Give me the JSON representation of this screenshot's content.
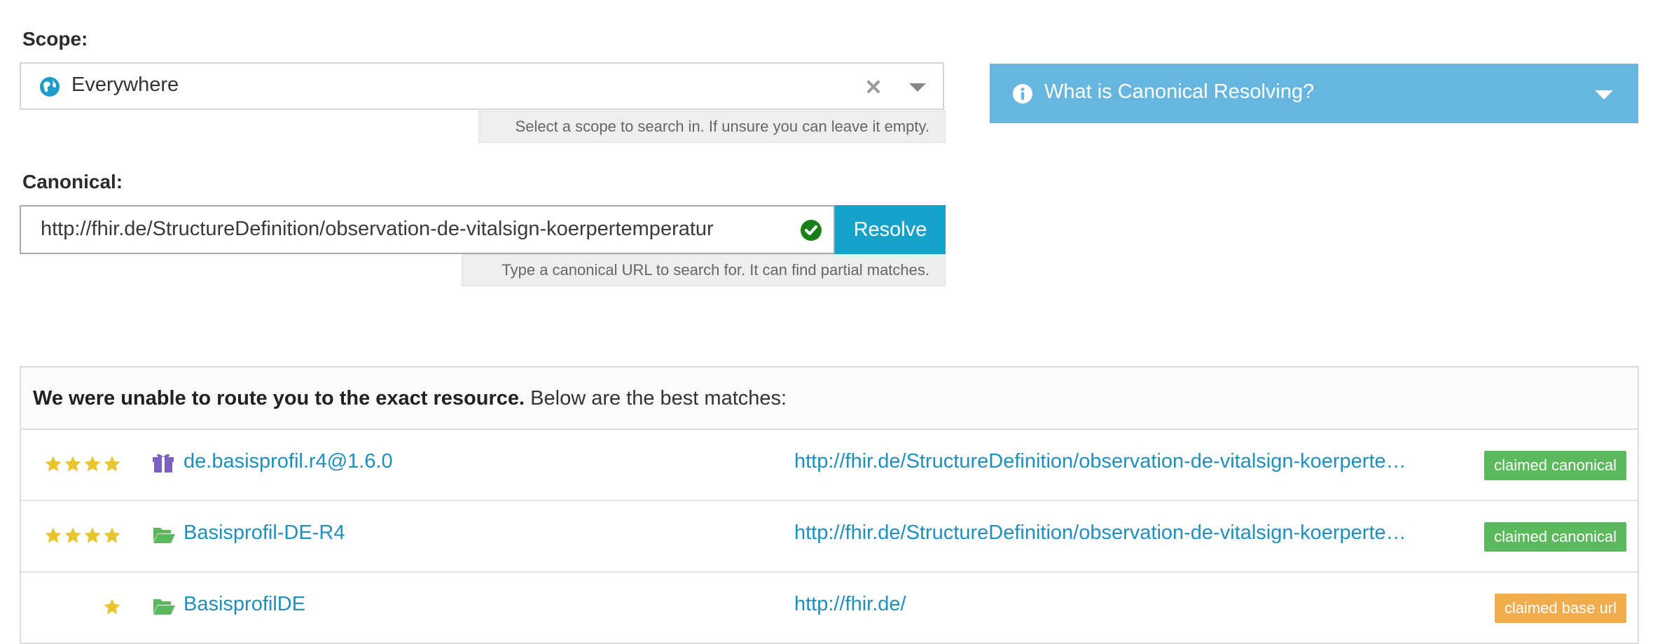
{
  "scope": {
    "label": "Scope:",
    "selected": "Everywhere",
    "hint": "Select a scope to search in. If unsure you can leave it empty."
  },
  "canonical": {
    "label": "Canonical:",
    "value": "http://fhir.de/StructureDefinition/observation-de-vitalsign-koerpertemperatur",
    "hint": "Type a canonical URL to search for. It can find partial matches.",
    "button_label": "Resolve"
  },
  "info_panel": {
    "title": "What is Canonical Resolving?"
  },
  "results": {
    "heading_bold": "We were unable to route you to the exact resource.",
    "heading_rest": " Below are the best matches:",
    "rows": [
      {
        "stars": 4,
        "icon": "package-icon",
        "name": "de.basisprofil.r4@1.6.0",
        "url": "http://fhir.de/StructureDefinition/observation-de-vitalsign-koerpertemperatur",
        "badge": "claimed canonical",
        "badge_color": "#5cb85c"
      },
      {
        "stars": 4,
        "icon": "folder-open-icon",
        "name": "Basisprofil-DE-R4",
        "url": "http://fhir.de/StructureDefinition/observation-de-vitalsign-koerpertemperatur",
        "badge": "claimed canonical",
        "badge_color": "#5cb85c"
      },
      {
        "stars": 1,
        "icon": "folder-open-icon",
        "name": "BasisprofilDE",
        "url": "http://fhir.de/",
        "badge": "claimed base url",
        "badge_color": "#f0ad4e"
      }
    ]
  },
  "colors": {
    "accent": "#17a2c9",
    "link": "#1f8fbd",
    "info_panel": "#67b6e0",
    "star": "#e8c52c",
    "package_icon": "#7b61c1",
    "folder_icon": "#5cb85c",
    "check_icon": "#1a7f1a"
  }
}
